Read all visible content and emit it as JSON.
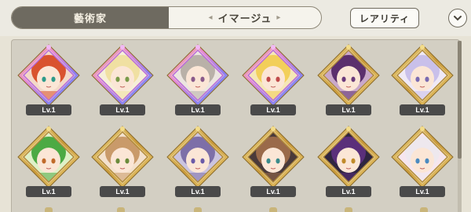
{
  "tabs": {
    "artist": "藝術家",
    "image": "イマージュ",
    "arrow_left": "◂",
    "arrow_right": "▸"
  },
  "buttons": {
    "rarity": "レアリティ",
    "sort_icon": "chevron-down-icon"
  },
  "colors": {
    "gold_frame": "#d9b85a",
    "rainbow_frame": "#c77ce0",
    "level_badge": "#4a4a4a"
  },
  "cards": [
    {
      "level": "Lv.1",
      "frame": "rainbow",
      "hair": "#d9532e",
      "bg": "#f3d9c8",
      "eye": "#2e9a8a"
    },
    {
      "level": "Lv.1",
      "frame": "rainbow",
      "hair": "#f0e0a2",
      "bg": "#f6efd8",
      "eye": "#7a9a4a"
    },
    {
      "level": "Lv.1",
      "frame": "rainbow",
      "hair": "#b9b1a8",
      "bg": "#ece6e0",
      "eye": "#8a5a8a"
    },
    {
      "level": "Lv.1",
      "frame": "rainbow",
      "hair": "#f2cf5a",
      "bg": "#f5e7b7",
      "eye": "#c04a4a"
    },
    {
      "level": "Lv.1",
      "frame": "gold",
      "hair": "#5b2f6d",
      "bg": "#c9a8c9",
      "eye": "#6a3a7a"
    },
    {
      "level": "Lv.1",
      "frame": "gold",
      "hair": "#c9c0ea",
      "bg": "#efe9f6",
      "eye": "#7a6ab0"
    },
    {
      "level": "Lv.1",
      "frame": "gold",
      "hair": "#4caa44",
      "bg": "#dff0c8",
      "eye": "#c06a2a"
    },
    {
      "level": "Lv.1",
      "frame": "gold",
      "hair": "#c99a6a",
      "bg": "#f3e1cd",
      "eye": "#6a8a3a"
    },
    {
      "level": "Lv.1",
      "frame": "gold",
      "hair": "#7d6fa8",
      "bg": "#cbc4df",
      "eye": "#6a5aa8"
    },
    {
      "level": "Lv.1",
      "frame": "gold",
      "hair": "#9a6a4a",
      "bg": "#4a3a3a",
      "eye": "#3a8a8a"
    },
    {
      "level": "Lv.1",
      "frame": "gold",
      "hair": "#5a2f7a",
      "bg": "#2f2540",
      "eye": "#c08a2a"
    },
    {
      "level": "Lv.1",
      "frame": "gold",
      "hair": "#eee8ee",
      "bg": "#f6e6ee",
      "eye": "#4a8ac0"
    }
  ]
}
